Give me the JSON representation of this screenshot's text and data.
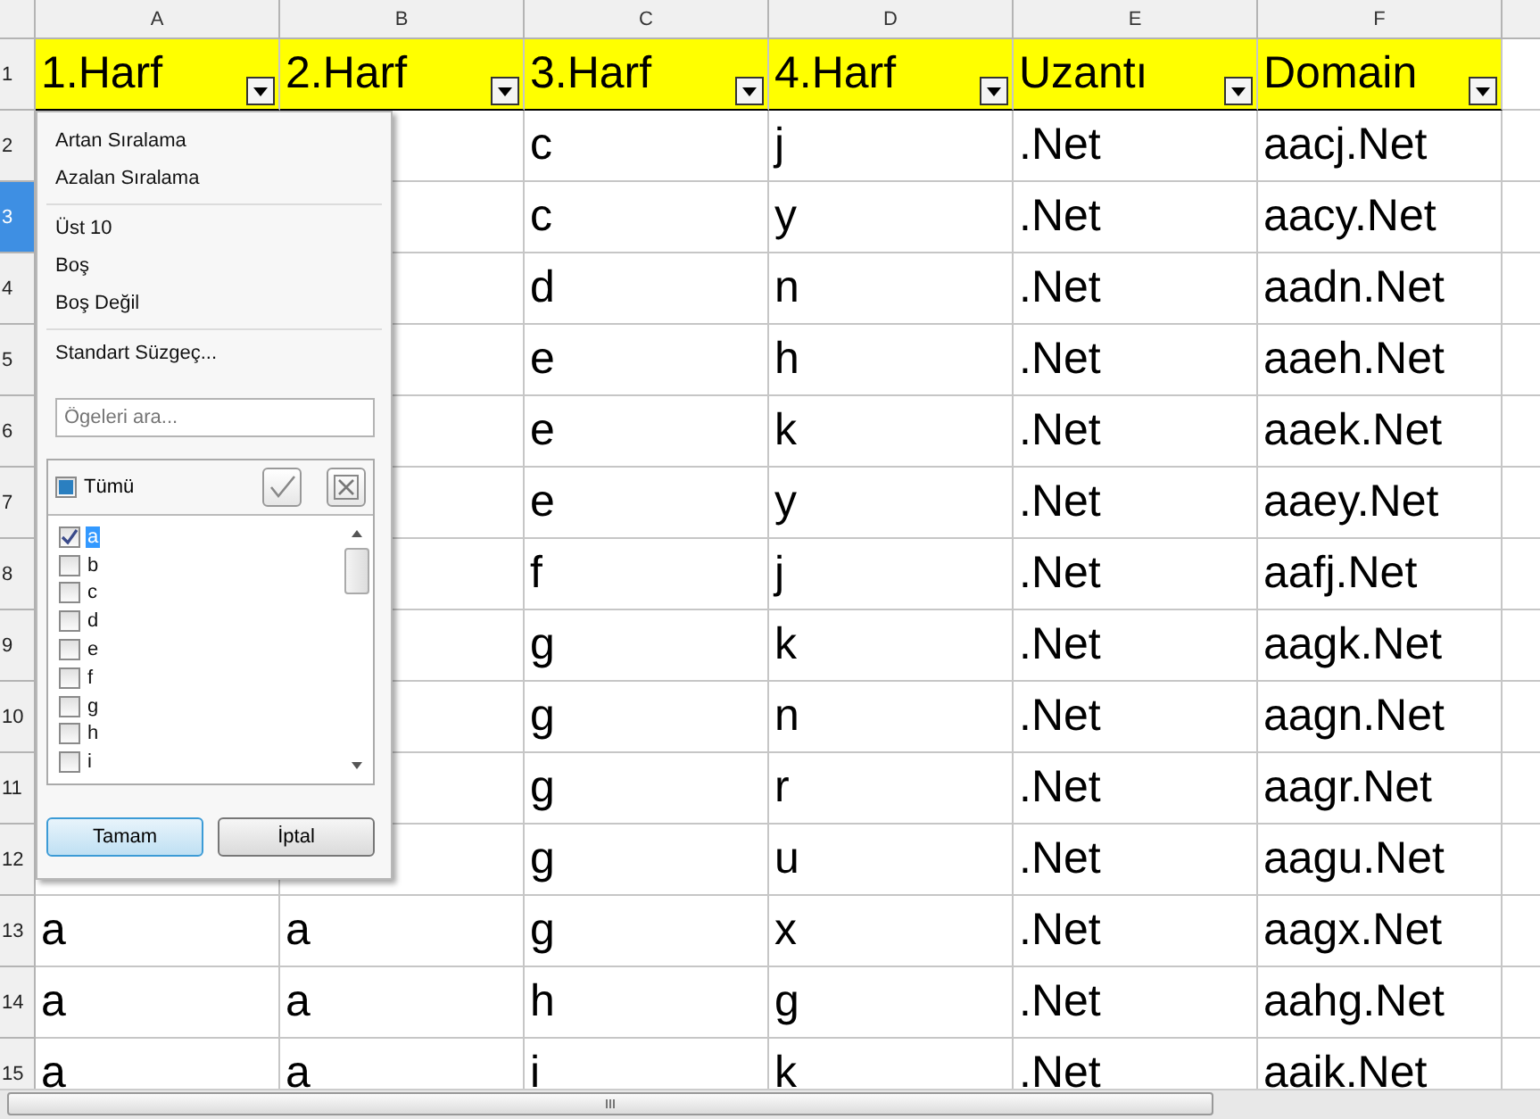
{
  "columns": [
    "A",
    "B",
    "C",
    "D",
    "E",
    "F"
  ],
  "header_row": {
    "number": "1",
    "selected": false,
    "cells": [
      "1.Harf",
      "2.Harf",
      "3.Harf",
      "4.Harf",
      "Uzantı",
      "Domain"
    ]
  },
  "rows": [
    {
      "number": "2",
      "selected": false,
      "cells": [
        null,
        null,
        "c",
        "j",
        ".Net",
        "aacj.Net"
      ]
    },
    {
      "number": "3",
      "selected": true,
      "cells": [
        null,
        null,
        "c",
        "y",
        ".Net",
        "aacy.Net"
      ]
    },
    {
      "number": "4",
      "selected": false,
      "cells": [
        null,
        null,
        "d",
        "n",
        ".Net",
        "aadn.Net"
      ]
    },
    {
      "number": "5",
      "selected": false,
      "cells": [
        null,
        null,
        "e",
        "h",
        ".Net",
        "aaeh.Net"
      ]
    },
    {
      "number": "6",
      "selected": false,
      "cells": [
        null,
        null,
        "e",
        "k",
        ".Net",
        "aaek.Net"
      ]
    },
    {
      "number": "7",
      "selected": false,
      "cells": [
        null,
        null,
        "e",
        "y",
        ".Net",
        "aaey.Net"
      ]
    },
    {
      "number": "8",
      "selected": false,
      "cells": [
        null,
        null,
        "f",
        "j",
        ".Net",
        "aafj.Net"
      ]
    },
    {
      "number": "9",
      "selected": false,
      "cells": [
        null,
        null,
        "g",
        "k",
        ".Net",
        "aagk.Net"
      ]
    },
    {
      "number": "10",
      "selected": false,
      "cells": [
        null,
        null,
        "g",
        "n",
        ".Net",
        "aagn.Net"
      ]
    },
    {
      "number": "11",
      "selected": false,
      "cells": [
        null,
        null,
        "g",
        "r",
        ".Net",
        "aagr.Net"
      ]
    },
    {
      "number": "12",
      "selected": false,
      "cells": [
        null,
        null,
        "g",
        "u",
        ".Net",
        "aagu.Net"
      ]
    },
    {
      "number": "13",
      "selected": false,
      "cells": [
        "a",
        "a",
        "g",
        "x",
        ".Net",
        "aagx.Net"
      ]
    },
    {
      "number": "14",
      "selected": false,
      "cells": [
        "a",
        "a",
        "h",
        "g",
        ".Net",
        "aahg.Net"
      ]
    },
    {
      "number": "15",
      "selected": false,
      "cells": [
        "a",
        "a",
        "i",
        "k",
        ".Net",
        "aaik.Net"
      ]
    }
  ],
  "filter_popup": {
    "menu_groups": [
      [
        "Artan Sıralama",
        "Azalan Sıralama"
      ],
      [
        "Üst 10",
        "Boş",
        "Boş Değil"
      ],
      [
        "Standart Süzgeç..."
      ]
    ],
    "search": {
      "placeholder": "Ögeleri ara..."
    },
    "all_label": "Tümü",
    "all_mixed": true,
    "items": [
      {
        "label": "a",
        "checked": true,
        "selected": true
      },
      {
        "label": "b",
        "checked": false,
        "selected": false
      },
      {
        "label": "c",
        "checked": false,
        "selected": false
      },
      {
        "label": "d",
        "checked": false,
        "selected": false
      },
      {
        "label": "e",
        "checked": false,
        "selected": false
      },
      {
        "label": "f",
        "checked": false,
        "selected": false
      },
      {
        "label": "g",
        "checked": false,
        "selected": false
      },
      {
        "label": "h",
        "checked": false,
        "selected": false
      },
      {
        "label": "i",
        "checked": false,
        "selected": false
      }
    ],
    "buttons": [
      "Tamam",
      "İptal"
    ]
  }
}
